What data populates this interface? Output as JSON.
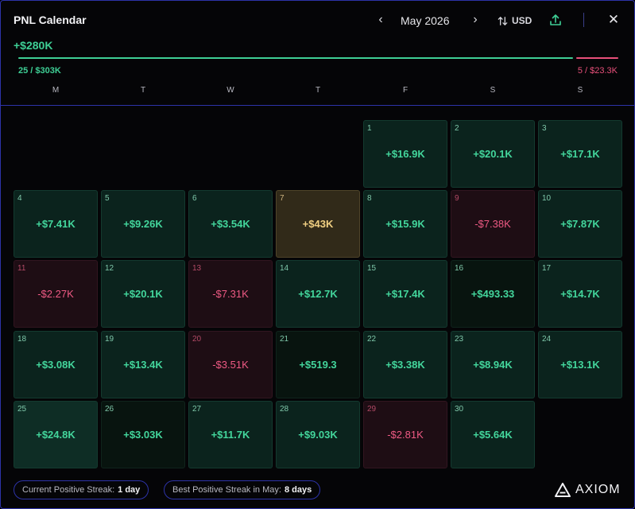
{
  "title": "PNL Calendar",
  "nav": {
    "prev": "‹",
    "month": "May 2026",
    "next": "›"
  },
  "currency": {
    "label": "USD",
    "icon": "sort-arrows-icon"
  },
  "close": "✕",
  "summary": {
    "total": "+$280K",
    "positive": "25 / $303K",
    "negative": "5 / $23.3K",
    "positive_fraction": 0.929,
    "colors": {
      "positive": "#3ecf95",
      "negative": "#e8507a",
      "accent_border": "#2d33a8"
    }
  },
  "weekdays": [
    "M",
    "T",
    "W",
    "T",
    "F",
    "S",
    "S"
  ],
  "days": [
    {
      "day": "1",
      "value": "+$16.9K",
      "type": "pos"
    },
    {
      "day": "2",
      "value": "+$20.1K",
      "type": "pos"
    },
    {
      "day": "3",
      "value": "+$17.1K",
      "type": "pos"
    },
    {
      "day": "4",
      "value": "+$7.41K",
      "type": "pos"
    },
    {
      "day": "5",
      "value": "+$9.26K",
      "type": "pos"
    },
    {
      "day": "6",
      "value": "+$3.54K",
      "type": "pos"
    },
    {
      "day": "7",
      "value": "+$43K",
      "type": "best"
    },
    {
      "day": "8",
      "value": "+$15.9K",
      "type": "pos"
    },
    {
      "day": "9",
      "value": "-$7.38K",
      "type": "neg"
    },
    {
      "day": "10",
      "value": "+$7.87K",
      "type": "pos"
    },
    {
      "day": "11",
      "value": "-$2.27K",
      "type": "neg"
    },
    {
      "day": "12",
      "value": "+$20.1K",
      "type": "pos"
    },
    {
      "day": "13",
      "value": "-$7.31K",
      "type": "neg"
    },
    {
      "day": "14",
      "value": "+$12.7K",
      "type": "pos"
    },
    {
      "day": "15",
      "value": "+$17.4K",
      "type": "pos"
    },
    {
      "day": "16",
      "value": "+$493.33",
      "type": "pos"
    },
    {
      "day": "17",
      "value": "+$14.7K",
      "type": "pos"
    },
    {
      "day": "18",
      "value": "+$3.08K",
      "type": "pos"
    },
    {
      "day": "19",
      "value": "+$13.4K",
      "type": "pos"
    },
    {
      "day": "20",
      "value": "-$3.51K",
      "type": "neg"
    },
    {
      "day": "21",
      "value": "+$519.3",
      "type": "pos"
    },
    {
      "day": "22",
      "value": "+$3.38K",
      "type": "pos"
    },
    {
      "day": "23",
      "value": "+$8.94K",
      "type": "pos"
    },
    {
      "day": "24",
      "value": "+$13.1K",
      "type": "pos"
    },
    {
      "day": "25",
      "value": "+$24.8K",
      "type": "pos"
    },
    {
      "day": "26",
      "value": "+$3.03K",
      "type": "pos"
    },
    {
      "day": "27",
      "value": "+$11.7K",
      "type": "pos"
    },
    {
      "day": "28",
      "value": "+$9.03K",
      "type": "pos"
    },
    {
      "day": "29",
      "value": "-$2.81K",
      "type": "neg"
    },
    {
      "day": "30",
      "value": "+$5.64K",
      "type": "pos"
    }
  ],
  "streaks": {
    "current_label": "Current Positive Streak:",
    "current_value": "1 day",
    "best_label": "Best Positive Streak in May:",
    "best_value": "8 days"
  },
  "brand": "AXIOM"
}
